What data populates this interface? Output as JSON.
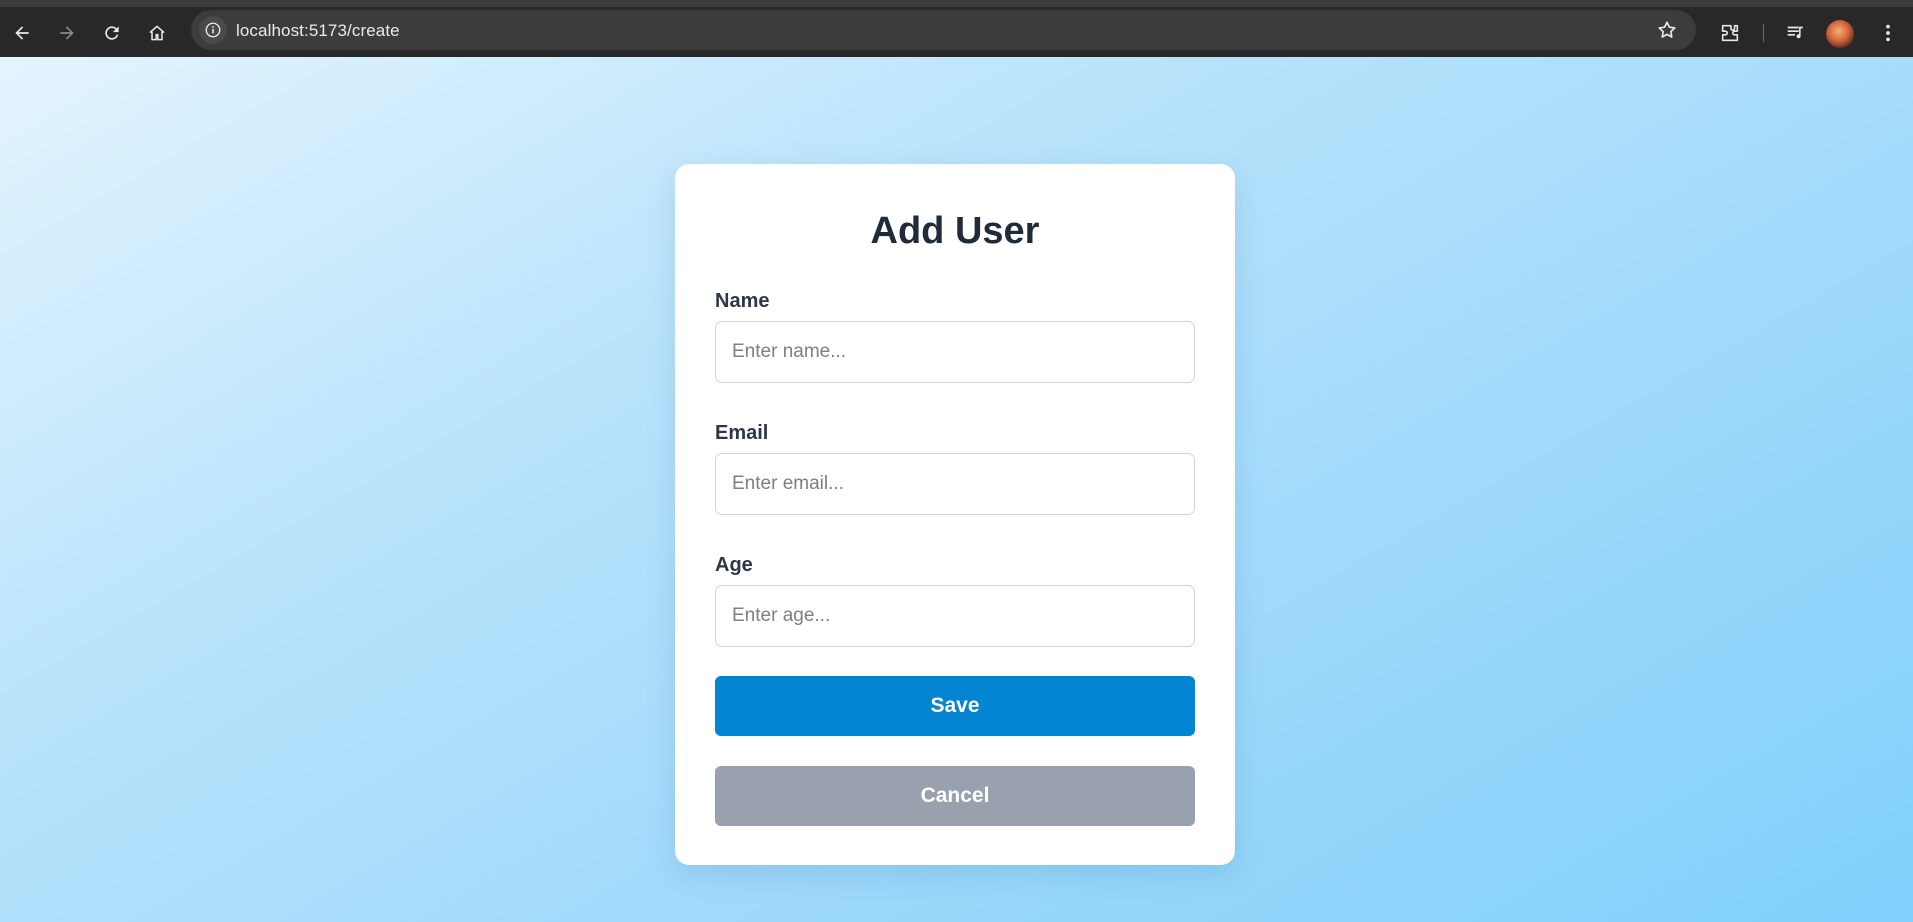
{
  "browser": {
    "url": "localhost:5173/create",
    "icons": [
      "back-arrow-icon",
      "forward-arrow-icon",
      "reload-icon",
      "home-icon",
      "site-info-icon",
      "bookmark-star-icon",
      "extensions-icon",
      "media-controls-icon",
      "profile-avatar",
      "menu-kebab-icon"
    ]
  },
  "form": {
    "title": "Add User",
    "fields": [
      {
        "label": "Name",
        "placeholder": "Enter name...",
        "value": ""
      },
      {
        "label": "Email",
        "placeholder": "Enter email...",
        "value": ""
      },
      {
        "label": "Age",
        "placeholder": "Enter age...",
        "value": ""
      }
    ],
    "save_label": "Save",
    "cancel_label": "Cancel"
  },
  "colors": {
    "save_button": "#0284d0",
    "cancel_button": "#9aa1ae",
    "title_text": "#1f2a3b",
    "background_gradient_start": "#e4f4fe",
    "background_gradient_end": "#7fd0fb"
  }
}
